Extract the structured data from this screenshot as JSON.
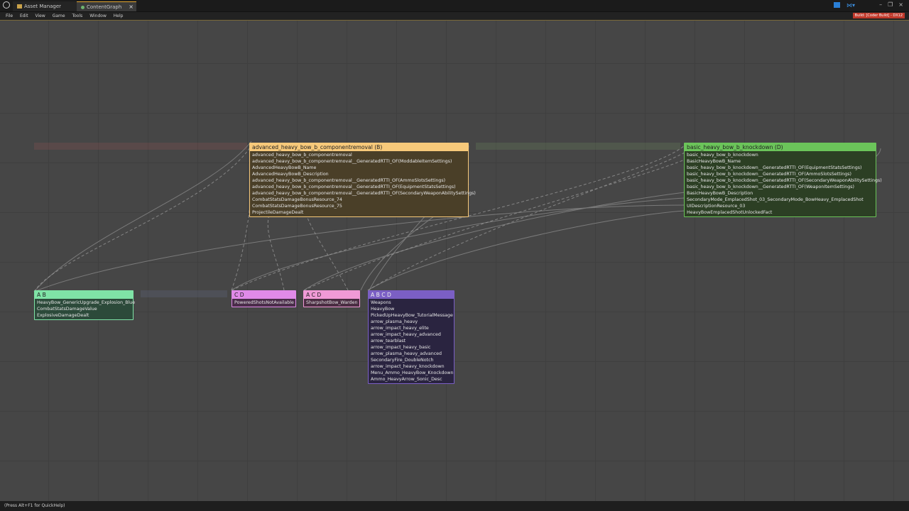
{
  "tabs": [
    {
      "label": "Asset Manager"
    },
    {
      "label": "ContentGraph",
      "close": "×"
    }
  ],
  "window_controls": [
    "–",
    "❐",
    "×"
  ],
  "menu": [
    "File",
    "Edit",
    "View",
    "Game",
    "Tools",
    "Window",
    "Help"
  ],
  "build_badge": "Build: [Coder Build] - DX12",
  "status_hint": "(Press Alt+F1 for QuickHelp)",
  "colors": {
    "node_b": "#f7c97a",
    "node_d": "#6bc45a",
    "node_ab": "#7fe3a6",
    "node_cd": "#e08ae8",
    "node_acd": "#f09ad6",
    "node_abcd": "#7b5fc4"
  },
  "nodes": {
    "b": {
      "title": "advanced_heavy_bow_b_componentremoval (B)",
      "rows": [
        "advanced_heavy_bow_b_componentremoval",
        "advanced_heavy_bow_b_componentremoval__GeneratedRTTI_OF(ModdableItemSettings)",
        "AdvancedHeavyBowB_Name",
        "AdvancedHeavyBowB_Description",
        "advanced_heavy_bow_b_componentremoval__GeneratedRTTI_OF(AmmoSlotsSettings)",
        "advanced_heavy_bow_b_componentremoval__GeneratedRTTI_OF(EquipmentStatsSettings)",
        "advanced_heavy_bow_b_componentremoval__GeneratedRTTI_OF(SecondaryWeaponAbilitySettings)",
        "CombatStatsDamageBonusResource_74",
        "CombatStatsDamageBonusResource_75",
        "ProjectileDamageDealt"
      ]
    },
    "d": {
      "title": "basic_heavy_bow_b_knockdown (D)",
      "rows": [
        "basic_heavy_bow_b_knockdown",
        "BasicHeavyBowB_Name",
        "basic_heavy_bow_b_knockdown__GeneratedRTTI_OF(EquipmentStatsSettings)",
        "basic_heavy_bow_b_knockdown__GeneratedRTTI_OF(AmmoSlotsSettings)",
        "basic_heavy_bow_b_knockdown__GeneratedRTTI_OF(SecondaryWeaponAbilitySettings)",
        "basic_heavy_bow_b_knockdown__GeneratedRTTI_OF(WeaponItemSettings)",
        "BasicHeavyBowB_Description",
        "SecondaryMode_EmplacedShot_03_SecondaryMode_BowHeavy_EmplacedShot",
        "UIDescriptionResource_03",
        "HeavyBowEmplacedShotUnlockedFact"
      ]
    },
    "ab": {
      "title": "A B",
      "rows": [
        "HeavyBow_GenericUpgrade_Explosion_Blue",
        "CombatStatsDamageValue",
        "ExplosiveDamageDealt"
      ]
    },
    "cd": {
      "title": "C D",
      "rows": [
        "PoweredShotsNotAvailable"
      ]
    },
    "acd": {
      "title": "A C D",
      "rows": [
        "SharpshotBow_Warden"
      ]
    },
    "abcd": {
      "title": "A B C D",
      "rows": [
        "Weapons",
        "HeavyBow",
        "PickedUpHeavyBow_TutorialMessage",
        "arrow_plasma_heavy",
        "arrow_impact_heavy_elite",
        "arrow_impact_heavy_advanced",
        "arrow_tearblast",
        "arrow_impact_heavy_basic",
        "arrow_plasma_heavy_advanced",
        "SecondaryFire_DoubleNotch",
        "arrow_impact_heavy_knockdown",
        "Menu_Ammo_HeavyBow_Knockdown",
        "Ammo_HeavyArrow_Sonic_Desc"
      ]
    }
  }
}
